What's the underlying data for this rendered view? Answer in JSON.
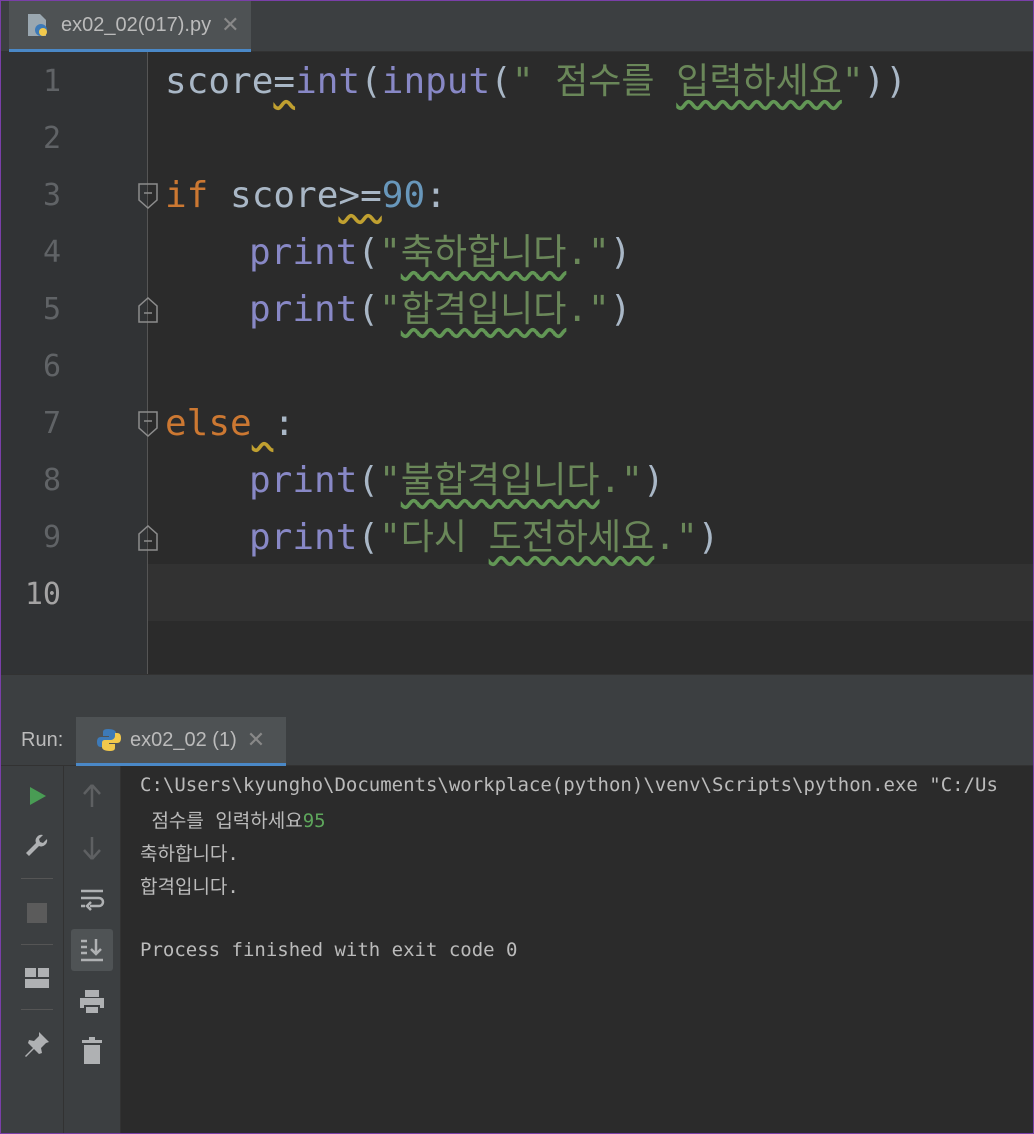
{
  "editor_tab": {
    "label": "ex02_02(017).py",
    "close": "✕"
  },
  "gutter": {
    "lines": [
      "1",
      "2",
      "3",
      "4",
      "5",
      "6",
      "7",
      "8",
      "9",
      "10"
    ]
  },
  "code": {
    "l1": {
      "a": "score",
      "b": "=",
      "c": "int",
      "d": "(",
      "e": "input",
      "f": "(",
      "g": "\" 점수를 ",
      "h": "입력하세요",
      "i": "\"",
      "j": "))"
    },
    "l3": {
      "a": "if",
      "b": " score",
      "c": ">=",
      "d": "90",
      "e": ":"
    },
    "l4": {
      "a": "print",
      "b": "(",
      "c": "\"",
      "d": "축하합니다",
      "e": ".\"",
      "f": ")"
    },
    "l5": {
      "a": "print",
      "b": "(",
      "c": "\"",
      "d": "합격입니다",
      "e": ".\"",
      "f": ")"
    },
    "l7": {
      "a": "else",
      "b": " ",
      "c": ":"
    },
    "l8": {
      "a": "print",
      "b": "(",
      "c": "\"",
      "d": "불합격입니다",
      "e": ".\"",
      "f": ")"
    },
    "l9": {
      "a": "print",
      "b": "(",
      "c": "\"다시 ",
      "d": "도전하세요",
      "e": ".\"",
      "f": ")"
    }
  },
  "run_panel": {
    "label": "Run:",
    "tab_label": "ex02_02 (1)",
    "tab_close": "✕"
  },
  "console": {
    "line1": "C:\\Users\\kyungho\\Documents\\workplace(python)\\venv\\Scripts\\python.exe \"C:/Us",
    "prompt": " 점수를 입력하세요",
    "input_value": "95",
    "line3": "축하합니다.",
    "line4": "합격입니다.",
    "line6": "Process finished with exit code 0"
  },
  "colors": {
    "keyword": "#cc7832",
    "builtin": "#8888c6",
    "string": "#6a8759",
    "number": "#6897bb",
    "run_green": "#499c54",
    "accent": "#4a88c7"
  }
}
